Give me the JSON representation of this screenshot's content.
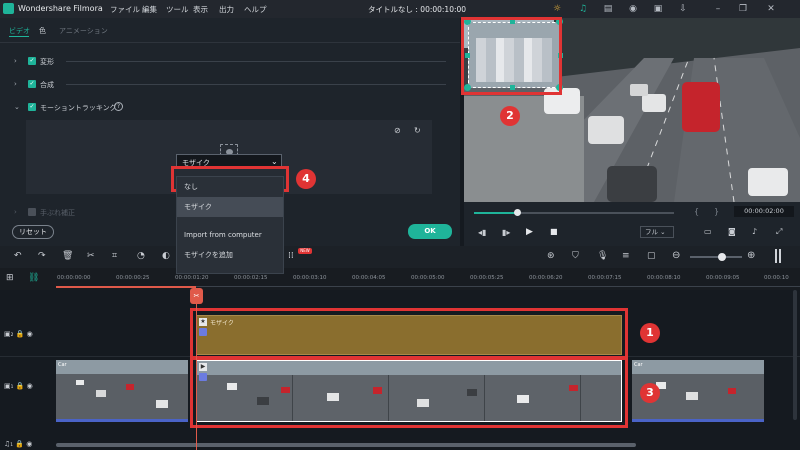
{
  "window": {
    "app_name": "Wondershare Filmora",
    "menus": [
      "ファイル",
      "編集",
      "ツール",
      "表示",
      "出力",
      "ヘルプ"
    ],
    "doc_title": "タイトルなし : 00:00:10:00"
  },
  "left_panel": {
    "tabs": [
      "ビデオ",
      "色",
      "アニメーション"
    ],
    "sections": [
      {
        "label": "変形"
      },
      {
        "label": "合成"
      },
      {
        "label": "モーショントラッキング"
      },
      {
        "label": "手ぶれ補正"
      }
    ],
    "tracking_dropdown": {
      "selected": "モザイク",
      "options": [
        "なし",
        "モザイク",
        "Import from computer",
        "モザイクを追加"
      ]
    },
    "reset_label": "リセット",
    "ok_label": "OK"
  },
  "preview": {
    "timecode": "00:00:02:00",
    "quality": "フル"
  },
  "timeline": {
    "ruler_labels": [
      "00:00:00:00",
      "00:00:00:25",
      "00:00:01:20",
      "00:00:02:15",
      "00:00:03:10",
      "00:00:04:05",
      "00:00:05:00",
      "00:00:05:25",
      "00:00:06:20",
      "00:00:07:15",
      "00:00:08:10",
      "00:00:09:05",
      "00:00:10"
    ],
    "mosaic_clip_label": "モザイク",
    "video_clip_label": "Car",
    "new_badge": "NEW"
  },
  "callouts": [
    "1",
    "2",
    "3",
    "4"
  ],
  "colors": {
    "accent": "#1fb49a",
    "highlight": "#e03434",
    "mosaic_track": "#8a6e2e",
    "playhead": "#e05a4a"
  }
}
